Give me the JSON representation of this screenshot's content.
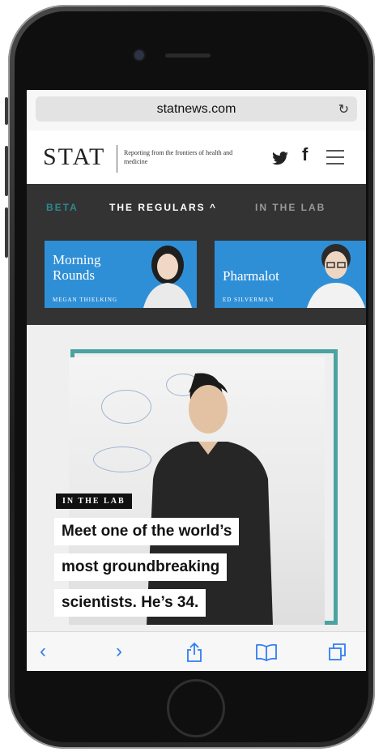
{
  "browser": {
    "url": "statnews.com"
  },
  "site": {
    "logo": "STAT",
    "tagline": "Reporting from the frontiers of health and medicine"
  },
  "nav": {
    "items": [
      "BETA",
      "THE REGULARS ^",
      "IN THE LAB"
    ]
  },
  "columns": [
    {
      "title": "Morning Rounds",
      "author": "MEGAN THIELKING"
    },
    {
      "title": "Pharmalot",
      "author": "ED SILVERMAN"
    }
  ],
  "article": {
    "section": "IN THE LAB",
    "headline_lines": [
      "Meet one of the world’s",
      "most groundbreaking",
      "scientists. He’s 34."
    ]
  },
  "colors": {
    "nav_bg": "#333333",
    "beta": "#2b8a8f",
    "column_card": "#2f8fd6",
    "frame": "#4aa3a0",
    "toolbar_icon": "#2f7df6"
  },
  "icons": [
    "reload-icon",
    "twitter-icon",
    "facebook-icon",
    "menu-icon",
    "back-icon",
    "forward-icon",
    "share-icon",
    "bookmarks-icon",
    "tabs-icon"
  ]
}
